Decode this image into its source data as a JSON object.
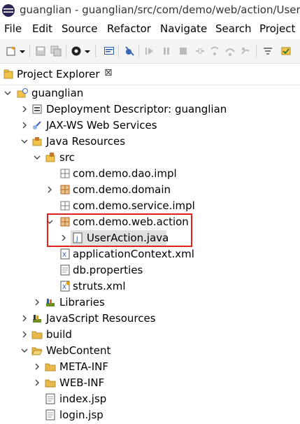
{
  "window": {
    "title": "guanglian - guanglian/src/com/demo/web/action/UserAction.java - Eclipse"
  },
  "menu": [
    "File",
    "Edit",
    "Source",
    "Refactor",
    "Navigate",
    "Search",
    "Project"
  ],
  "view": {
    "tab_label": "Project Explorer",
    "close_glyph": "⊠"
  },
  "tree": {
    "project": "guanglian",
    "deployment_descriptor": "Deployment Descriptor: guanglian",
    "jaxws": "JAX-WS Web Services",
    "java_resources": "Java Resources",
    "src": "src",
    "pkg_dao": "com.demo.dao.impl",
    "pkg_domain": "com.demo.domain",
    "pkg_service": "com.demo.service.impl",
    "pkg_action": "com.demo.web.action",
    "file_useraction": "UserAction.java",
    "file_appctx": "applicationContext.xml",
    "file_dbprops": "db.properties",
    "file_struts": "struts.xml",
    "libraries": "Libraries",
    "js_resources": "JavaScript Resources",
    "build": "build",
    "webcontent": "WebContent",
    "meta_inf": "META-INF",
    "web_inf": "WEB-INF",
    "index_jsp": "index.jsp",
    "login_jsp": "login.jsp"
  },
  "colors": {
    "highlight_box": "#e0201c",
    "selection": "#e0e0e0",
    "package": "#b5651d",
    "folder": "#e8b84a"
  }
}
